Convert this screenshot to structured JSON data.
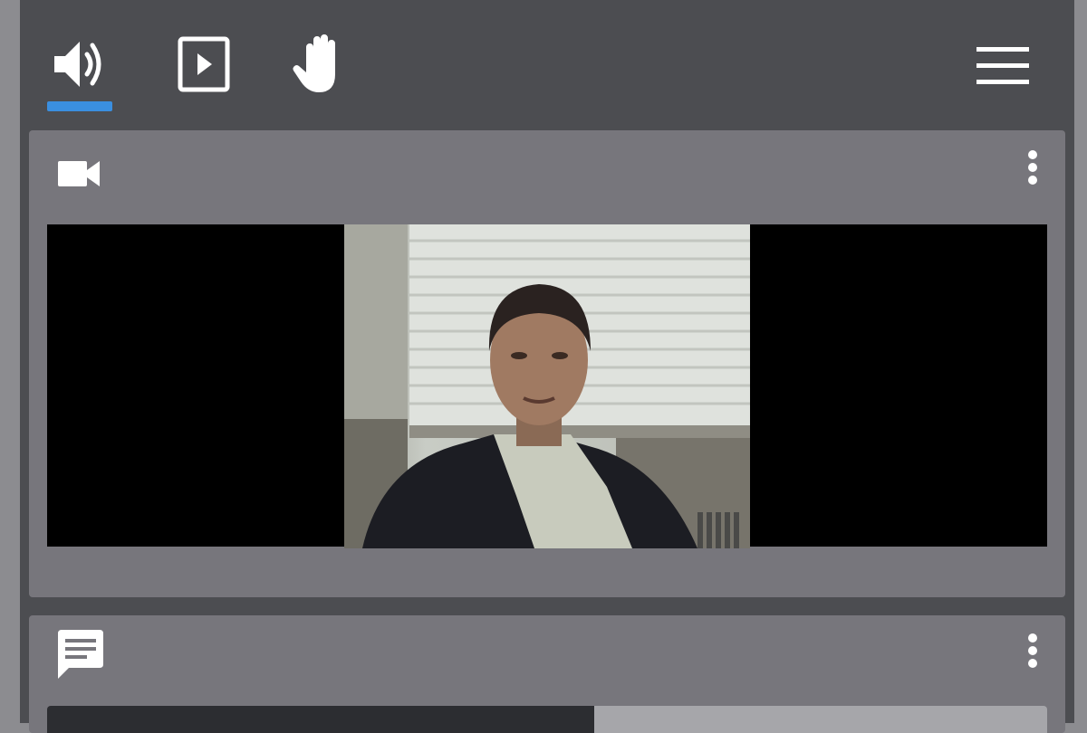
{
  "toolbar": {
    "buttons": [
      {
        "name": "audio",
        "icon": "speaker-icon",
        "active": true
      },
      {
        "name": "present",
        "icon": "play-square-icon",
        "active": false
      },
      {
        "name": "raise-hand",
        "icon": "hand-icon",
        "active": false
      }
    ],
    "menu_icon": "hamburger-menu-icon",
    "accent_color": "#3a8fe0"
  },
  "video_panel": {
    "icon": "video-camera-icon",
    "options_icon": "vertical-dots-icon"
  },
  "chat_panel": {
    "icon": "chat-bubble-icon",
    "options_icon": "vertical-dots-icon"
  },
  "colors": {
    "toolbar_bg": "#4c4d51",
    "panel_bg": "#77767c",
    "video_bg": "#000000",
    "icon": "#ffffff"
  }
}
